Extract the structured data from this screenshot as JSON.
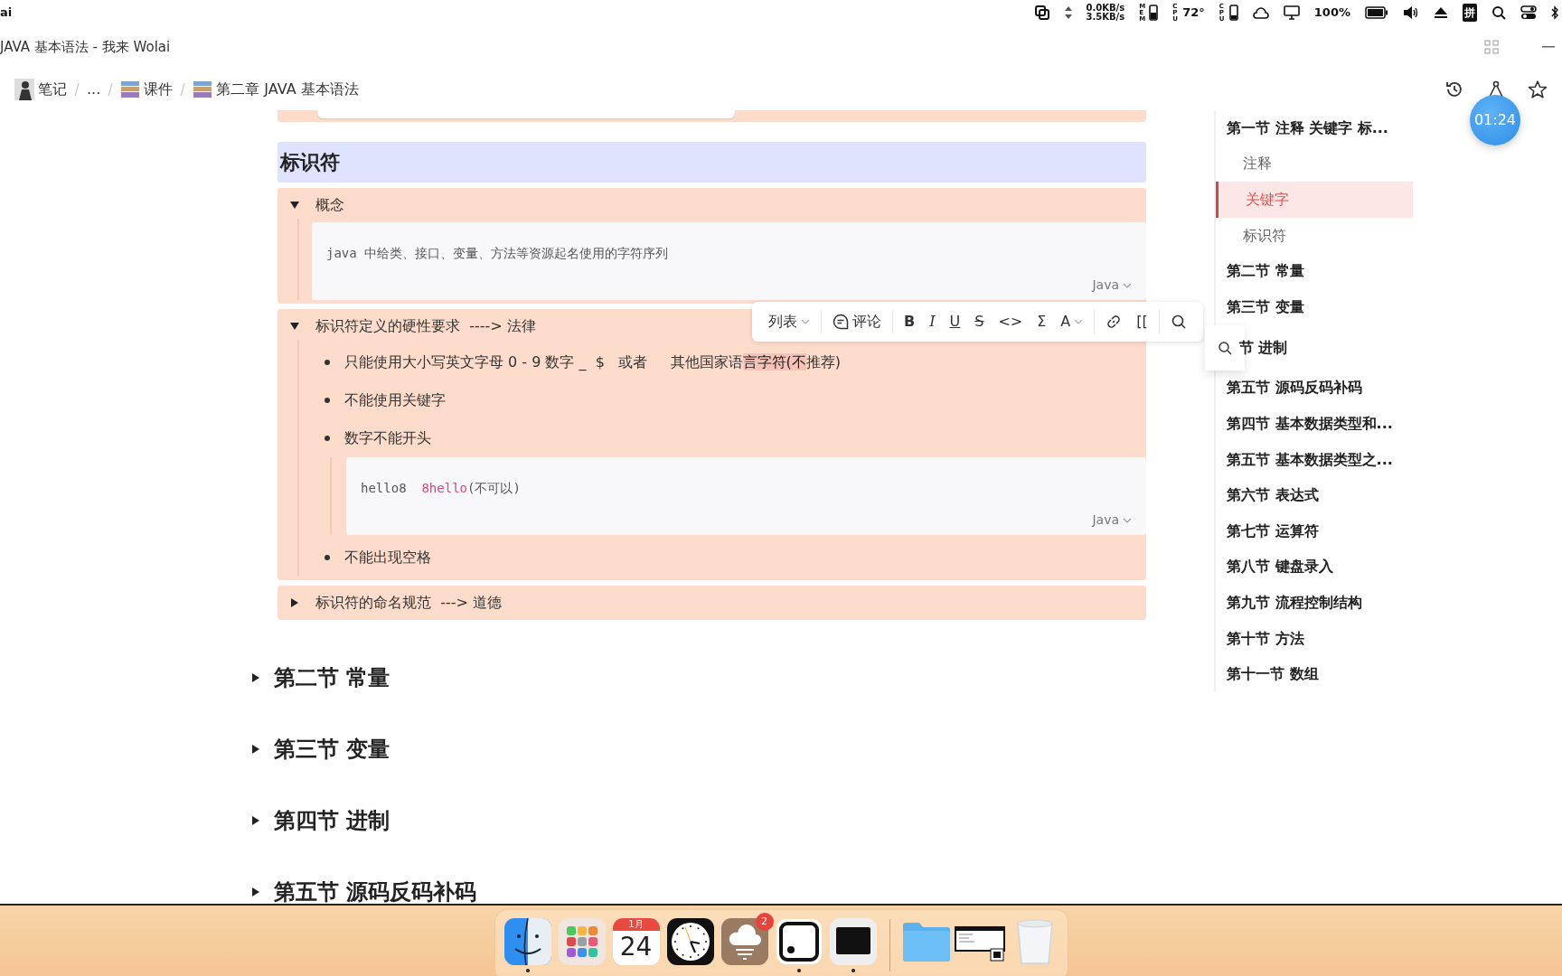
{
  "menu_bar": {
    "app_name": "ai",
    "net_speed": [
      "0.0KB/s",
      "3.5KB/s"
    ],
    "mem_label": "MEM",
    "cpu_label": "CPU",
    "cpu_temp": "72°",
    "gpu_label": "CPU",
    "battery": "100%",
    "input_method": "拼"
  },
  "window": {
    "title": "JAVA 基本语法 - 我来 Wolai"
  },
  "breadcrumb": [
    {
      "label": "笔记",
      "kind": "avatar"
    },
    {
      "label": "...",
      "kind": "plain"
    },
    {
      "label": "课件",
      "kind": "book"
    },
    {
      "label": "第二章 JAVA 基本语法",
      "kind": "book"
    }
  ],
  "timer": "01:24",
  "heading": "标识符",
  "blocks": [
    {
      "kind": "toggle",
      "title": "概念",
      "expanded": true,
      "children": [
        {
          "kind": "code",
          "language": "Java",
          "tokens": [
            {
              "text": "java 中给类、接口、变量、方法等资源起名使用的字符序列",
              "kind": "plain"
            }
          ]
        }
      ]
    },
    {
      "kind": "toggle",
      "title": "标识符定义的硬性要求  ----> 法律",
      "expanded": true,
      "children": [
        {
          "kind": "bullet",
          "segments": [
            {
              "text": "只能使用大小写英文字母 0 - 9 数字 _  $   或者     其他国家语",
              "highlighted": false
            },
            {
              "text": "言字符(不",
              "highlighted": true
            },
            {
              "text": "推荐)",
              "highlighted": false
            }
          ]
        },
        {
          "kind": "bullet",
          "segments": [
            {
              "text": "不能使用关键字",
              "highlighted": false
            }
          ]
        },
        {
          "kind": "bullet",
          "segments": [
            {
              "text": "数字不能开头",
              "highlighted": false
            }
          ],
          "children": [
            {
              "kind": "code",
              "language": "Java",
              "tokens": [
                {
                  "text": "hello8  ",
                  "kind": "plain"
                },
                {
                  "text": "8hello",
                  "kind": "number"
                },
                {
                  "text": "(不可以)",
                  "kind": "plain"
                }
              ]
            }
          ]
        },
        {
          "kind": "bullet",
          "segments": [
            {
              "text": "不能出现空格",
              "highlighted": false
            }
          ]
        }
      ]
    },
    {
      "kind": "toggle",
      "title": "标识符的命名规范  ---> 道德",
      "expanded": false
    }
  ],
  "sections": [
    {
      "title": "第二节 常量",
      "expanded": false
    },
    {
      "title": "第三节 变量",
      "expanded": false
    },
    {
      "title": "第四节 进制",
      "expanded": false
    },
    {
      "title": "第五节 源码反码补码",
      "expanded": false
    }
  ],
  "format_toolbar": [
    {
      "items": [
        {
          "kind": "dropdown",
          "label": "列表"
        }
      ]
    },
    {
      "items": [
        {
          "kind": "comment",
          "label": "评论"
        }
      ]
    },
    {
      "items": [
        {
          "kind": "bold",
          "label": "B"
        },
        {
          "kind": "italic",
          "label": "I"
        },
        {
          "kind": "underline",
          "label": "U"
        },
        {
          "kind": "strike",
          "label": "S"
        },
        {
          "kind": "text",
          "label": "<>"
        },
        {
          "kind": "text",
          "label": "Σ"
        },
        {
          "kind": "dropdown",
          "label": "A"
        }
      ]
    },
    {
      "items": [
        {
          "kind": "link"
        },
        {
          "kind": "text",
          "label": "[["
        }
      ]
    },
    {
      "items": [
        {
          "kind": "search"
        }
      ]
    }
  ],
  "outline": [
    {
      "label": "第一节 注释 关键字 标...",
      "kind": "entry",
      "selected": false,
      "children": [
        {
          "label": "注释",
          "kind": "entry",
          "selected": false
        },
        {
          "label": "关键字",
          "kind": "entry",
          "selected": true
        },
        {
          "label": "标识符",
          "kind": "entry",
          "selected": false
        }
      ]
    },
    {
      "label": "第二节 常量",
      "kind": "entry",
      "selected": false
    },
    {
      "label": "第三节 变量",
      "kind": "entry",
      "selected": false
    },
    {
      "label": "节 进制",
      "kind": "covered",
      "selected": false
    },
    {
      "label": "第五节 源码反码补码",
      "kind": "entry",
      "selected": false
    },
    {
      "label": "第四节 基本数据类型和...",
      "kind": "entry",
      "selected": false
    },
    {
      "label": "第五节 基本数据类型之...",
      "kind": "entry",
      "selected": false
    },
    {
      "label": "第六节 表达式",
      "kind": "entry",
      "selected": false
    },
    {
      "label": "第七节 运算符",
      "kind": "entry",
      "selected": false
    },
    {
      "label": "第八节 键盘录入",
      "kind": "entry",
      "selected": false
    },
    {
      "label": "第九节 流程控制结构",
      "kind": "entry",
      "selected": false
    },
    {
      "label": "第十节 方法",
      "kind": "entry",
      "selected": false
    },
    {
      "label": "第十一节 数组",
      "kind": "entry",
      "selected": false
    }
  ],
  "dock": {
    "apps": [
      {
        "kind": "finder",
        "running": true
      },
      {
        "kind": "launchpad",
        "running": false
      },
      {
        "kind": "calendar",
        "month": "1月",
        "day": "24",
        "running": false
      },
      {
        "kind": "clock",
        "running": false
      },
      {
        "kind": "weather",
        "badge": "2",
        "running": false
      },
      {
        "kind": "notes",
        "running": true
      },
      {
        "kind": "terminal",
        "running": true
      }
    ],
    "stacks": [
      {
        "kind": "folder",
        "running": false
      },
      {
        "kind": "window",
        "running": false
      },
      {
        "kind": "trash",
        "running": false
      }
    ]
  }
}
